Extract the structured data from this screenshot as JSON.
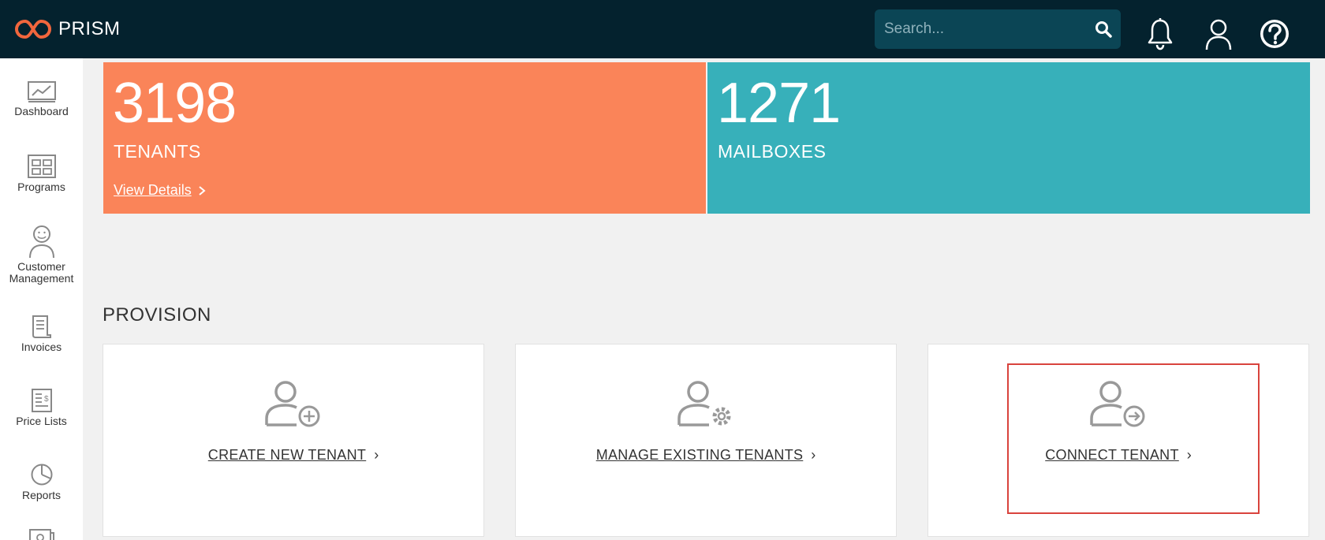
{
  "header": {
    "brand": "PRISM",
    "search_placeholder": "Search..."
  },
  "sidebar": {
    "items": [
      {
        "label": "Dashboard",
        "icon": "chart-icon"
      },
      {
        "label": "Programs",
        "icon": "grid-icon"
      },
      {
        "label": "Customer Management",
        "icon": "customer-icon"
      },
      {
        "label": "Invoices",
        "icon": "invoice-icon"
      },
      {
        "label": "Price Lists",
        "icon": "price-list-icon"
      },
      {
        "label": "Reports",
        "icon": "pie-icon"
      }
    ]
  },
  "stats": {
    "tenants": {
      "value": "3198",
      "label": "TENANTS",
      "link": "View Details"
    },
    "mailboxes": {
      "value": "1271",
      "label": "MAILBOXES"
    }
  },
  "provision": {
    "title": "PROVISION",
    "cards": [
      {
        "label": "CREATE NEW TENANT",
        "icon": "user-add-icon"
      },
      {
        "label": "MANAGE EXISTING TENANTS",
        "icon": "user-settings-icon"
      },
      {
        "label": "CONNECT TENANT",
        "icon": "user-connect-icon"
      }
    ]
  },
  "colors": {
    "topbar": "#04222e",
    "search_bg": "#0b4555",
    "tenants_tile": "#fa8459",
    "mailboxes_tile": "#37b0ba",
    "highlight": "#d9433d",
    "logo": "#f1663d"
  }
}
